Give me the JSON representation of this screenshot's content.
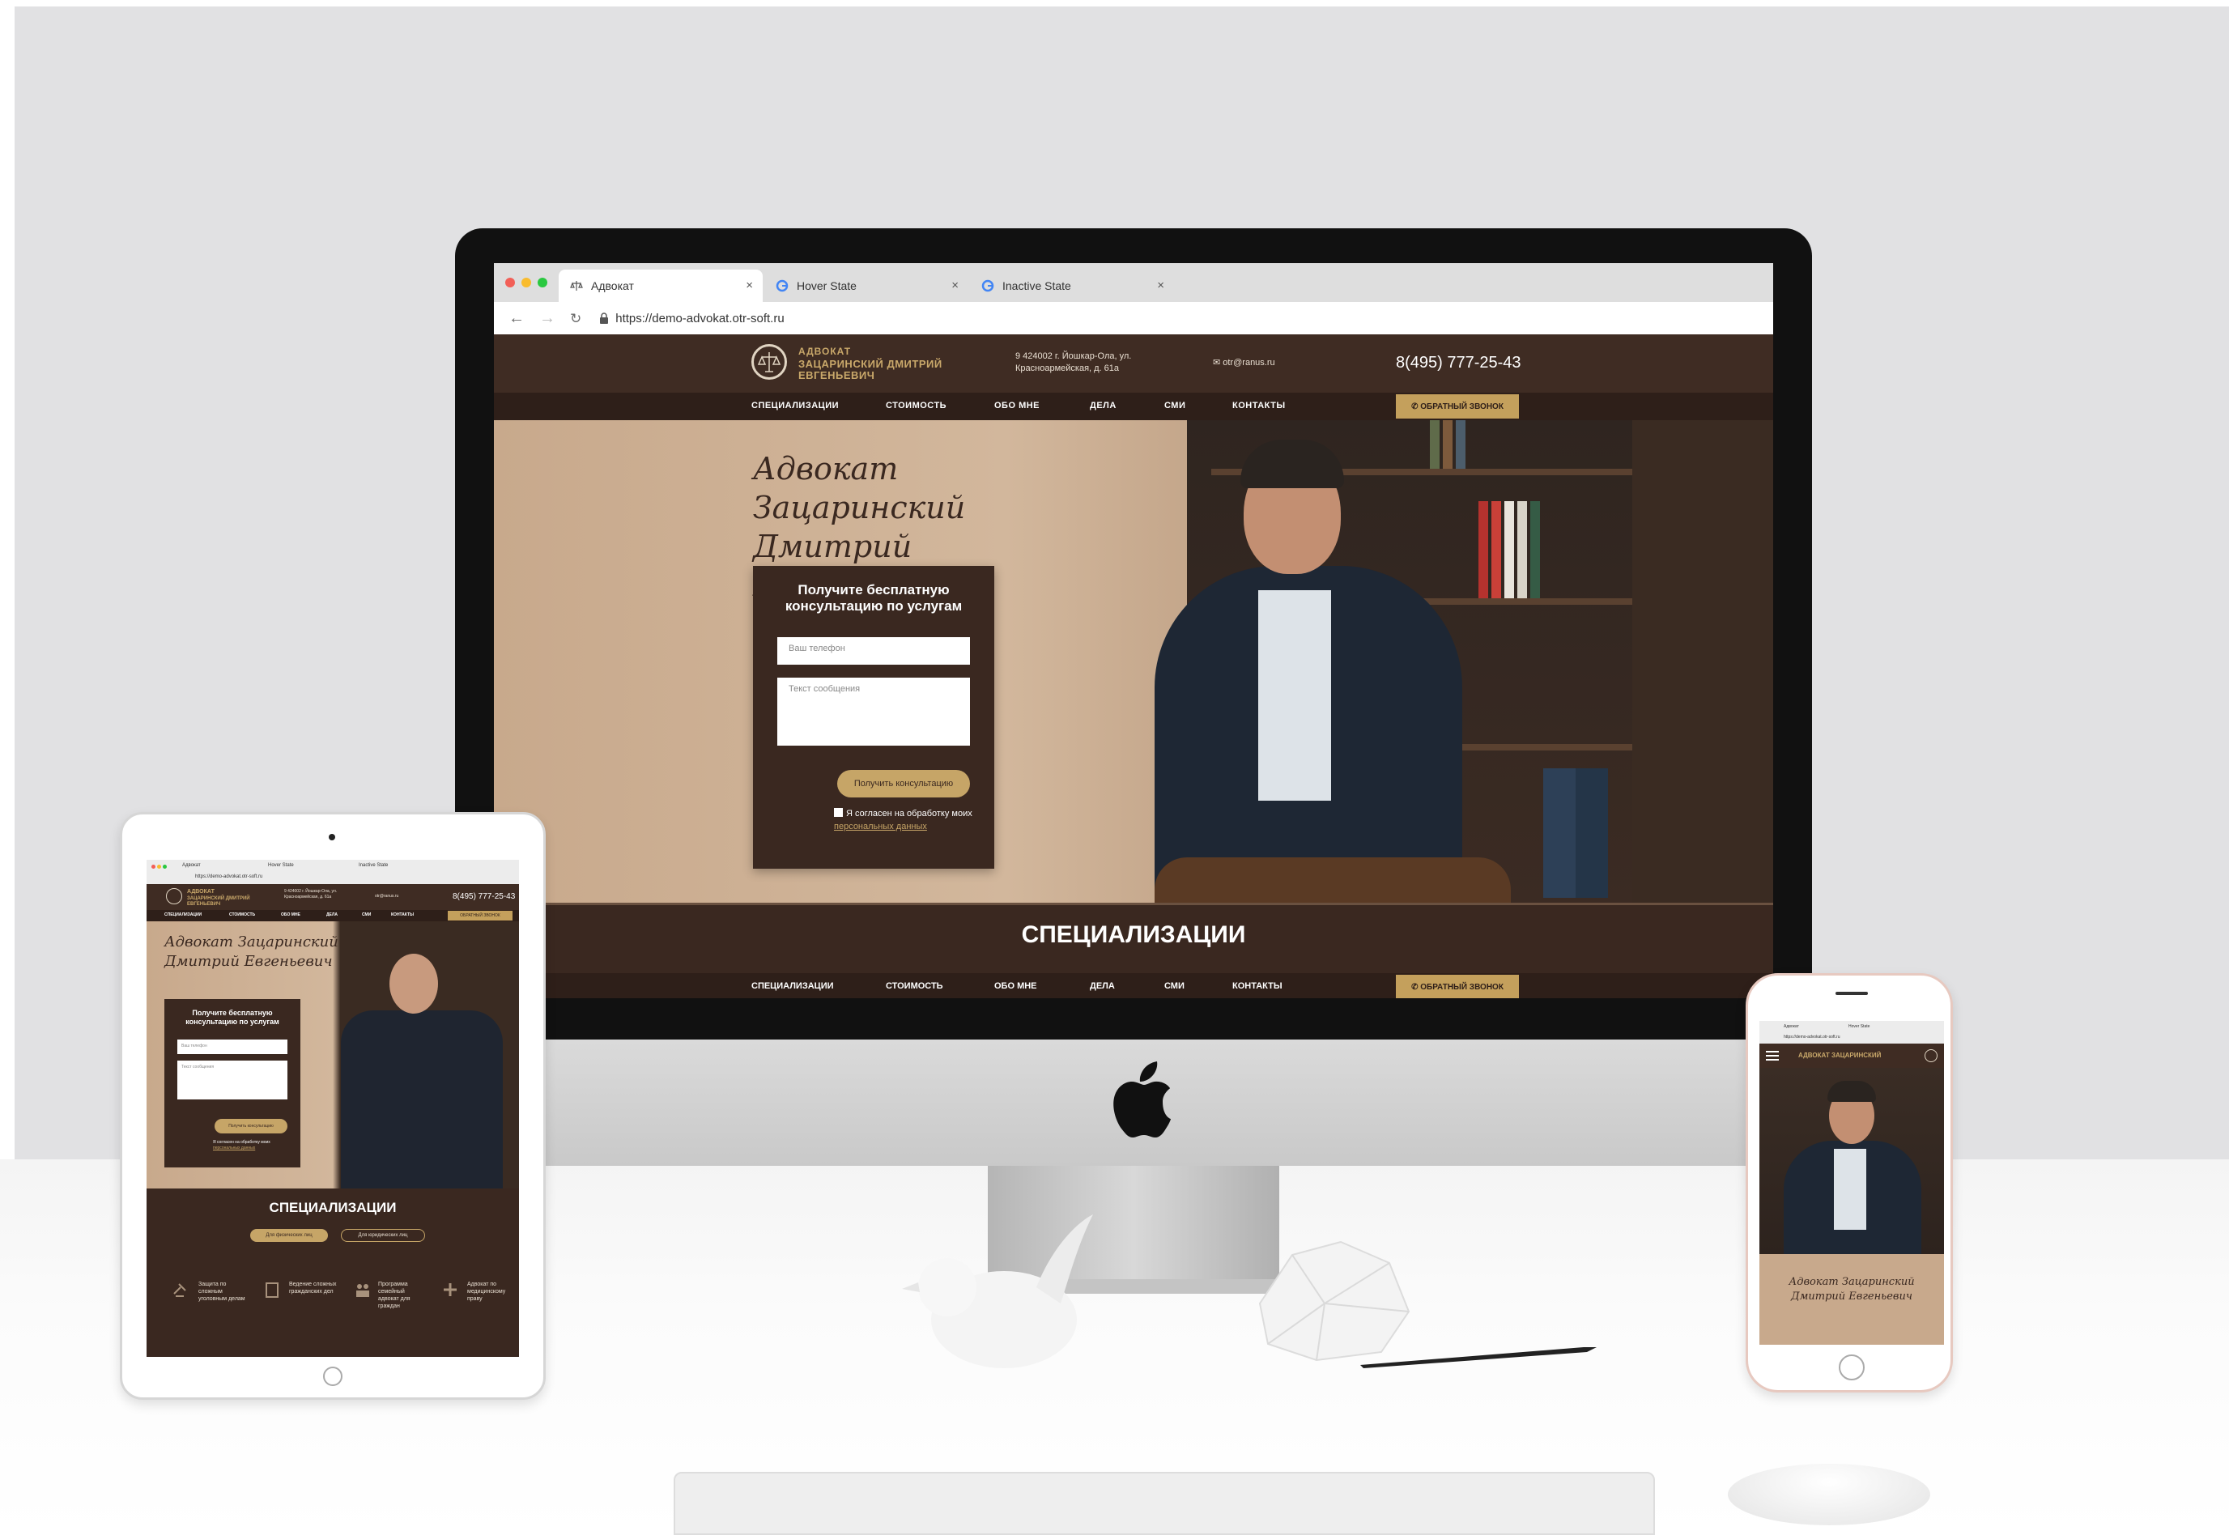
{
  "browser": {
    "tabs": [
      {
        "label": "Адвокат",
        "active": true
      },
      {
        "label": "Hover State",
        "active": false
      },
      {
        "label": "Inactive State",
        "active": false
      }
    ],
    "url": "https://demo-advokat.otr-soft.ru"
  },
  "header": {
    "logo_line1": "АДВОКАТ",
    "logo_line2": "ЗАЦАРИНСКИЙ ДМИТРИЙ ЕВГЕНЬЕВИЧ",
    "address": "9 424002 г. Йошкар-Ола, ул. Красноармейская, д. 61а",
    "email": "otr@ranus.ru",
    "phone": "8(495) 777-25-43"
  },
  "menu": {
    "items": [
      "СПЕЦИАЛИЗАЦИИ",
      "СТОИМОСТЬ",
      "ОБО МНЕ",
      "ДЕЛА",
      "СМИ",
      "КОНТАКТЫ"
    ],
    "callback": "ОБРАТНЫЙ ЗВОНОК"
  },
  "hero": {
    "title_line1": "Адвокат Зацаринский",
    "title_line2": "Дмитрий Евгеньевич"
  },
  "form": {
    "heading_line1": "Получите бесплатную",
    "heading_line2": "консультацию по услугам",
    "phone_placeholder": "Ваш телефон",
    "message_placeholder": "Текст сообщения",
    "submit": "Получить консультацию",
    "agree_text": "Я согласен на обработку моих",
    "agree_link": "персональных данных"
  },
  "specializations": {
    "title": "СПЕЦИАЛИЗАЦИИ",
    "btn_individuals": "Для физических лиц",
    "btn_legal": "Для юридических лиц",
    "features": [
      "Защита по сложным уголовным делам",
      "Ведение сложных гражданских дел",
      "Программа семейный адвокат для граждан",
      "Адвокат по медицинскому праву"
    ]
  },
  "mobile": {
    "header_title": "АДВОКАТ ЗАЦАРИНСКИЙ"
  },
  "colors": {
    "brand_brown": "#3a2820",
    "gold": "#c6a567"
  }
}
